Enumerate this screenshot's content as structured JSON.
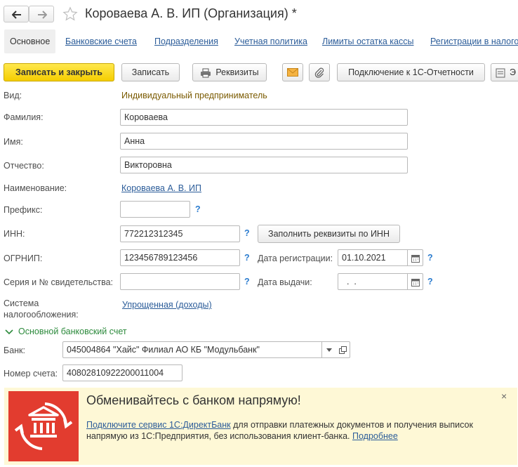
{
  "header": {
    "title": "Короваева А. В. ИП (Организация) *"
  },
  "tabs": [
    {
      "label": "Основное"
    },
    {
      "label": "Банковские счета"
    },
    {
      "label": "Подразделения"
    },
    {
      "label": "Учетная политика"
    },
    {
      "label": "Лимиты остатка кассы"
    },
    {
      "label": "Регистрации в налоговых"
    }
  ],
  "toolbar": {
    "save_close": "Записать и закрыть",
    "save": "Записать",
    "requisites": "Реквизиты",
    "connect_1c": "Подключение к 1С-Отчетности",
    "more": "Э"
  },
  "form": {
    "kind_label": "Вид:",
    "kind_value": "Индивидуальный предприниматель",
    "surname_label": "Фамилия:",
    "surname_value": "Короваева",
    "name_label": "Имя:",
    "name_value": "Анна",
    "patronymic_label": "Отчество:",
    "patronymic_value": "Викторовна",
    "title_label": "Наименование:",
    "title_value": "Короваева А. В. ИП",
    "prefix_label": "Префикс:",
    "prefix_value": "",
    "inn_label": "ИНН:",
    "inn_value": "772212312345",
    "fill_by_inn": "Заполнить реквизиты по ИНН",
    "ogrnip_label": "ОГРНИП:",
    "ogrnip_value": "123456789123456",
    "reg_date_label": "Дата регистрации:",
    "reg_date_value": "01.10.2021",
    "cert_label": "Серия и № свидетельства:",
    "cert_value": "",
    "issue_date_label": "Дата выдачи:",
    "issue_date_value": "  .  .",
    "tax_label_1": "Система",
    "tax_label_2": "налогообложения:",
    "tax_value": "Упрощенная (доходы)",
    "help": "?"
  },
  "bank": {
    "section_title": "Основной банковский счет",
    "bank_label": "Банк:",
    "bank_value": "045004864 \"Хайс\" Филиал АО КБ \"Модульбанк\"",
    "account_label": "Номер счета:",
    "account_value": "40802810922200011004"
  },
  "promo": {
    "title": "Обменивайтесь с банком напрямую!",
    "link": "Подключите сервис 1С:ДиректБанк",
    "text1": " для отправки платежных документов и получения выписок",
    "text2": "напрямую из 1С:Предприятия, без использования клиент-банка. ",
    "more": "Подробнее",
    "close": "×"
  },
  "colors": {
    "accent_yellow": "#f5cd00",
    "link_blue": "#2b5c99",
    "section_green": "#2c8a3c",
    "promo_bg": "#fef8d6",
    "promo_red": "#e23c2f"
  }
}
